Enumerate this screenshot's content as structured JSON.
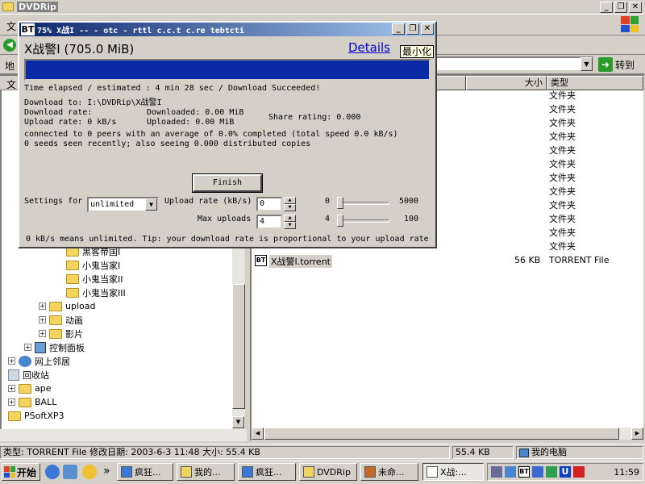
{
  "explorer": {
    "title": "DVDRip",
    "menu_first": "文",
    "address_label": "地",
    "go_label": "转到",
    "tree_header": "文",
    "columns": {
      "size": "大小",
      "type": "类型"
    }
  },
  "tree": {
    "items": [
      {
        "label": "黑客帝国I",
        "indent": 82,
        "expander": false,
        "icon": "folder"
      },
      {
        "label": "小鬼当家I",
        "indent": 82,
        "expander": false,
        "icon": "folder"
      },
      {
        "label": "小鬼当家II",
        "indent": 82,
        "expander": false,
        "icon": "folder"
      },
      {
        "label": "小鬼当家III",
        "indent": 82,
        "expander": false,
        "icon": "folder"
      },
      {
        "label": "upload",
        "indent": 48,
        "expander": true,
        "icon": "folder"
      },
      {
        "label": "动画",
        "indent": 48,
        "expander": true,
        "icon": "folder"
      },
      {
        "label": "影片",
        "indent": 48,
        "expander": true,
        "icon": "folder"
      },
      {
        "label": "控制面板",
        "indent": 30,
        "expander": true,
        "icon": "control"
      },
      {
        "label": "网上邻居",
        "indent": 10,
        "expander": true,
        "icon": "network"
      },
      {
        "label": "回收站",
        "indent": 10,
        "expander": false,
        "icon": "bin"
      },
      {
        "label": "ape",
        "indent": 10,
        "expander": true,
        "icon": "folder"
      },
      {
        "label": "BALL",
        "indent": 10,
        "expander": true,
        "icon": "folder"
      },
      {
        "label": "PSoftXP3",
        "indent": 10,
        "expander": false,
        "icon": "folder"
      }
    ]
  },
  "files": {
    "folder_type": "文件夹",
    "folder_rows": 12,
    "torrent": {
      "name": "X战警I.torrent",
      "size": "56 KB",
      "type": "TORRENT File"
    }
  },
  "status": {
    "info": "类型: TORRENT File 修改日期: 2003-6-3 11:48 大小: 55.4 KB",
    "size": "55.4 KB",
    "location": "我的电脑"
  },
  "taskbar": {
    "start": "开始",
    "more": "»",
    "buttons": [
      {
        "label": "疯狂...",
        "active": false
      },
      {
        "label": "我的...",
        "active": false
      },
      {
        "label": "疯狂...",
        "active": false
      },
      {
        "label": "DVDRip",
        "active": false
      },
      {
        "label": "未命...",
        "active": false
      },
      {
        "label": "X战:...",
        "active": true
      }
    ],
    "clock": "11:59"
  },
  "bt": {
    "logo": "BT",
    "title": "75% X战I -- - otc - rttl c.c.t   c.re tebtcti",
    "filename": "X战警I (705.0 MiB)",
    "details_link": "Details",
    "tooltip": "最小化",
    "progress": 1.0,
    "time_line": "Time elapsed / estimated : 4 min 28 sec / Download Succeeded!",
    "download_to": "Download to:  I:\\DVDRip\\X战警I",
    "download_rate": "Download rate:",
    "upload_rate": "Upload rate:    0 kB/s",
    "downloaded": "Downloaded:  0.00 MiB",
    "uploaded": "Uploaded:    0.00 MiB",
    "share_rating": "Share rating:  0.000",
    "peers_line": "connected to 0 peers with an average of 0.0% completed (total speed 0.0 kB/s)",
    "seeds_line": "0 seeds seen recently; also seeing 0.000 distributed copies",
    "finish_label": "Finish",
    "settings_label": "Settings for",
    "settings_value": "unlimited",
    "upload_rate_label": "Upload rate (kB/s)",
    "upload_rate_value": "0",
    "upload_min": "0",
    "upload_max": "5000",
    "max_uploads_label": "Max uploads",
    "max_uploads_value": "4",
    "uploads_min": "4",
    "uploads_max": "100",
    "tip": "0 kB/s means unlimited. Tip: your download rate is proportional to your upload rate"
  }
}
